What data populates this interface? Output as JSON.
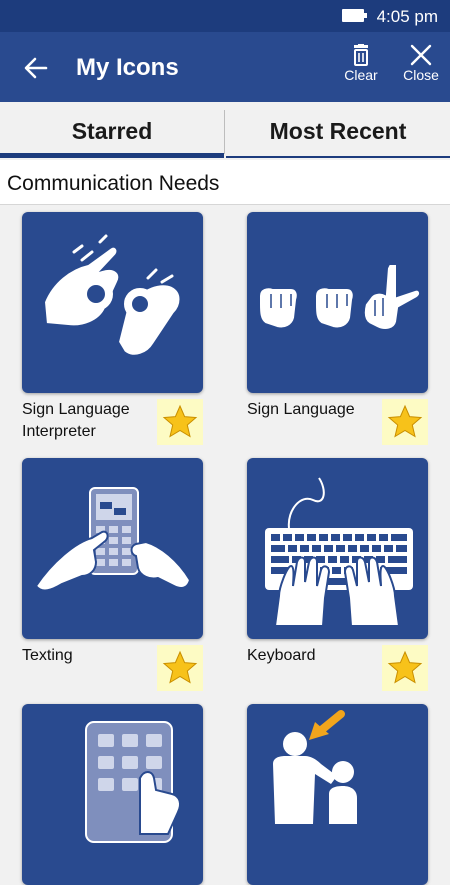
{
  "status_bar": {
    "time": "4:05 pm"
  },
  "app_bar": {
    "title": "My Icons",
    "clear_label": "Clear",
    "close_label": "Close"
  },
  "tabs": [
    {
      "label": "Starred",
      "selected": true
    },
    {
      "label": "Most Recent",
      "selected": false
    }
  ],
  "section": {
    "title": "Communication Needs"
  },
  "items": [
    {
      "label": "Sign Language Interpreter",
      "icon": "sign-language-interpreter-icon",
      "starred": true
    },
    {
      "label": "Sign Language",
      "icon": "sign-language-icon",
      "starred": true
    },
    {
      "label": "Texting",
      "icon": "texting-icon",
      "starred": true
    },
    {
      "label": "Keyboard",
      "icon": "keyboard-icon",
      "starred": true
    },
    {
      "label": "",
      "icon": "tablet-icon",
      "starred": true
    },
    {
      "label": "",
      "icon": "assistance-icon",
      "starred": true
    }
  ],
  "colors": {
    "status_bar": "#1d3c7d",
    "app_bar": "#294a8f",
    "card": "#294a8f",
    "star": "#f7c21a",
    "star_bg": "#fdfbc4",
    "assist_arrow": "#f2a51c"
  }
}
